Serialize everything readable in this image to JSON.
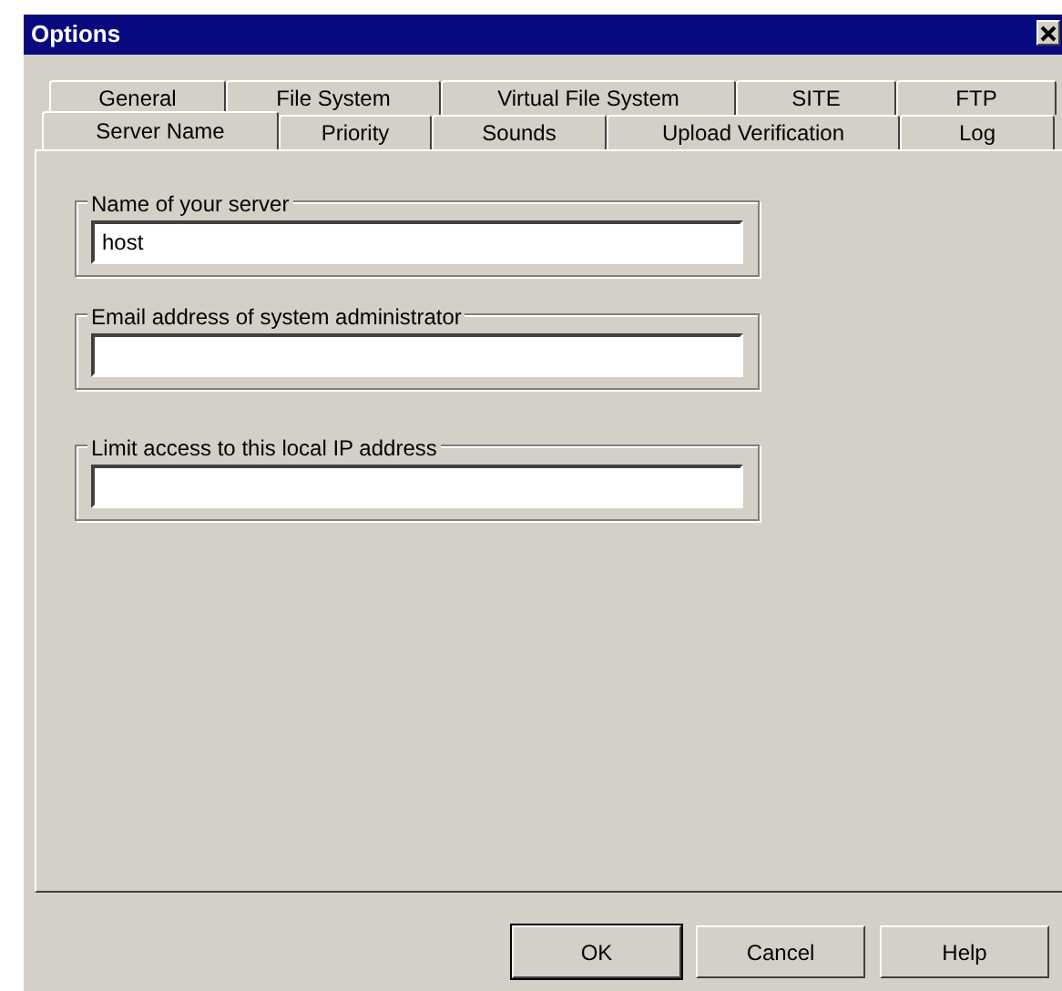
{
  "window": {
    "title": "Options"
  },
  "tab_rows": [
    [
      {
        "label": "General",
        "selected": false
      },
      {
        "label": "File System",
        "selected": false
      },
      {
        "label": "Virtual File System",
        "selected": false
      },
      {
        "label": "SITE",
        "selected": false
      },
      {
        "label": "FTP",
        "selected": false
      }
    ],
    [
      {
        "label": "Server Name",
        "selected": true
      },
      {
        "label": "Priority",
        "selected": false
      },
      {
        "label": "Sounds",
        "selected": false
      },
      {
        "label": "Upload Verification",
        "selected": false
      },
      {
        "label": "Log",
        "selected": false
      }
    ]
  ],
  "groups": [
    {
      "label": "Name of your server",
      "value": "host"
    },
    {
      "label": "Email address of system administrator"
    },
    {
      "label": "Limit access to this local IP address"
    }
  ],
  "buttons": [
    {
      "label": "OK",
      "default": true
    },
    {
      "label": "Cancel",
      "default": false
    },
    {
      "label": "Help",
      "default": false
    }
  ]
}
